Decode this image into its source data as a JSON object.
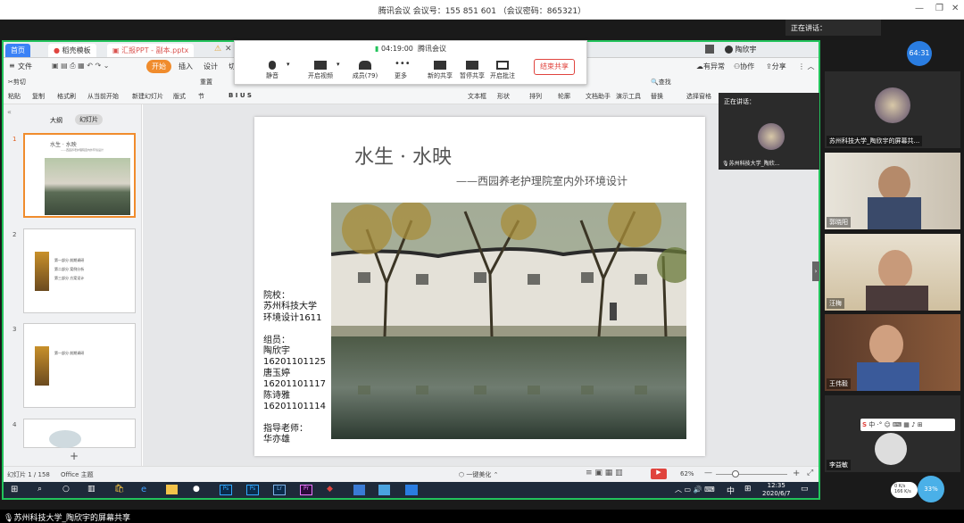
{
  "meeting_title": "腾讯会议 会议号：155 851 601 （会议密码：865321）",
  "speaking_top": {
    "label": "正在讲话：",
    "name": ""
  },
  "timer_badge": "64:31",
  "toolbar": {
    "elapsed": "04:19:00",
    "app": "腾讯会议",
    "mute": "静音",
    "video": "开启视频",
    "members": "成员(79)",
    "more": "更多",
    "new_share": "新的共享",
    "pause_share": "暂停共享",
    "annotate": "开启批注",
    "stop_share": "结束共享"
  },
  "wps": {
    "tabs": [
      "首页",
      "稻壳模板",
      "汇报PPT - 副本.pptx"
    ],
    "user": "陶欣宇",
    "menus": [
      "文件",
      "开始",
      "插入",
      "设计",
      "切"
    ],
    "right_menu": [
      "有异常",
      "协作",
      "分享"
    ],
    "ribbon_items": [
      "剪切",
      "粘贴",
      "复制",
      "格式刷",
      "从当前开始",
      "新建幻灯片",
      "版式",
      "节",
      "重置",
      "文本框",
      "形状",
      "排列",
      "轮廓",
      "文档助手",
      "演示工具",
      "查找",
      "替换",
      "选择窗格"
    ],
    "panel_tabs": [
      "大纲",
      "幻灯片"
    ],
    "status_slide": "幻灯片 1 / 158",
    "status_theme": "Office 主题",
    "status_beautify": "一键美化",
    "zoom": "62%"
  },
  "slide": {
    "title": "水生 · 水映",
    "subtitle": "——西园养老护理院室内外环境设计",
    "info_lines": [
      "院校：",
      "苏州科技大学",
      "环境设计1611",
      "",
      "组员：",
      "陶欣宇",
      "16201101125",
      "唐玉婷",
      "16201101117",
      "陈诗雅",
      "16201101114",
      "",
      "指导老师：",
      "华亦雄"
    ]
  },
  "thumbs": [
    {
      "num": "1",
      "title": "水生 · 水映",
      "sub": "——西园养老护理院室内外环境设计"
    },
    {
      "num": "2",
      "items": [
        "第一部分",
        "前期调研",
        "第二部分",
        "案例分析",
        "第三部分",
        "方案设计"
      ]
    },
    {
      "num": "3",
      "items": [
        "第一部分",
        "前期调研"
      ]
    },
    {
      "num": "4"
    }
  ],
  "speaking_panel": {
    "label": "正在讲话：",
    "name": "苏州科技大学_陶欣..."
  },
  "participants": [
    {
      "name": "苏州科技大学_陶欣宇的屏幕共..."
    },
    {
      "name": "郭晓阳"
    },
    {
      "name": "汪梅"
    },
    {
      "name": "王伟毅"
    },
    {
      "name": "李益敏"
    }
  ],
  "taskbar": {
    "time": "12:35",
    "date": "2020/6/7",
    "ime": "中"
  },
  "bottom_label": "苏州科技大学_陶欣宇的屏幕共享",
  "net": {
    "up": "0 K/s",
    "down": "166 K/s",
    "pct": "33%"
  },
  "colors": {
    "accent_green": "#22c35b",
    "wps_red": "#d9534f",
    "stop_red": "#e0443e"
  }
}
